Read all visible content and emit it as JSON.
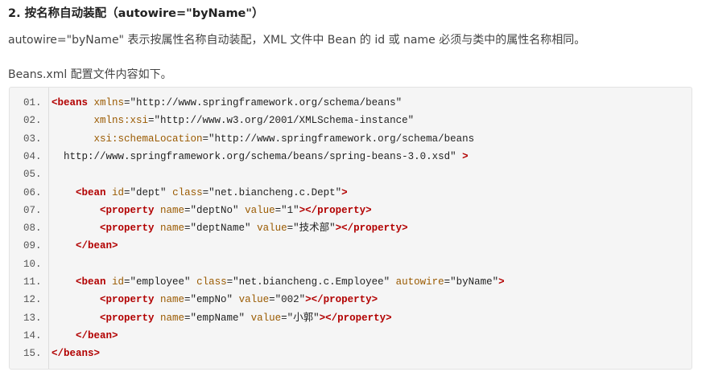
{
  "heading": "2. 按名称自动装配（autowire=\"byName\"）",
  "description": "autowire=\"byName\" 表示按属性名称自动装配，XML 文件中 Bean 的 id 或 name 必须与类中的属性名称相同。",
  "intro": "Beans.xml 配置文件内容如下。",
  "code": {
    "lines": [
      {
        "num": "01.",
        "indent": "",
        "parts": [
          {
            "t": "<beans",
            "c": "tag"
          },
          {
            "t": " xmlns",
            "c": "attr"
          },
          {
            "t": "=\"http://www.springframework.org/schema/beans\"",
            "c": "val"
          }
        ]
      },
      {
        "num": "02.",
        "indent": "       ",
        "parts": [
          {
            "t": "xmlns:xsi",
            "c": "attr"
          },
          {
            "t": "=\"http://www.w3.org/2001/XMLSchema-instance\"",
            "c": "val"
          }
        ]
      },
      {
        "num": "03.",
        "indent": "       ",
        "parts": [
          {
            "t": "xsi:schemaLocation",
            "c": "attr"
          },
          {
            "t": "=\"http://www.springframework.org/schema/beans",
            "c": "val"
          }
        ]
      },
      {
        "num": "04.",
        "indent": "  ",
        "parts": [
          {
            "t": "http://www.springframework.org/schema/beans/spring-beans-3.0.xsd\" ",
            "c": "val"
          },
          {
            "t": ">",
            "c": "tag"
          }
        ]
      },
      {
        "num": "05.",
        "indent": "",
        "parts": []
      },
      {
        "num": "06.",
        "indent": "    ",
        "parts": [
          {
            "t": "<bean",
            "c": "tag"
          },
          {
            "t": " id",
            "c": "attr"
          },
          {
            "t": "=\"dept\"",
            "c": "val"
          },
          {
            "t": " class",
            "c": "attr"
          },
          {
            "t": "=\"net.biancheng.c.Dept\"",
            "c": "val"
          },
          {
            "t": ">",
            "c": "tag"
          }
        ]
      },
      {
        "num": "07.",
        "indent": "        ",
        "parts": [
          {
            "t": "<property",
            "c": "tag"
          },
          {
            "t": " name",
            "c": "attr"
          },
          {
            "t": "=\"deptNo\"",
            "c": "val"
          },
          {
            "t": " value",
            "c": "attr"
          },
          {
            "t": "=\"1\"",
            "c": "val"
          },
          {
            "t": "></property>",
            "c": "tag"
          }
        ]
      },
      {
        "num": "08.",
        "indent": "        ",
        "parts": [
          {
            "t": "<property",
            "c": "tag"
          },
          {
            "t": " name",
            "c": "attr"
          },
          {
            "t": "=\"deptName\"",
            "c": "val"
          },
          {
            "t": " value",
            "c": "attr"
          },
          {
            "t": "=\"技术部\"",
            "c": "val"
          },
          {
            "t": "></property>",
            "c": "tag"
          }
        ]
      },
      {
        "num": "09.",
        "indent": "    ",
        "parts": [
          {
            "t": "</bean>",
            "c": "tag"
          }
        ]
      },
      {
        "num": "10.",
        "indent": "",
        "parts": []
      },
      {
        "num": "11.",
        "indent": "    ",
        "parts": [
          {
            "t": "<bean",
            "c": "tag"
          },
          {
            "t": " id",
            "c": "attr"
          },
          {
            "t": "=\"employee\"",
            "c": "val"
          },
          {
            "t": " class",
            "c": "attr"
          },
          {
            "t": "=\"net.biancheng.c.Employee\"",
            "c": "val"
          },
          {
            "t": " autowire",
            "c": "attr"
          },
          {
            "t": "=\"byName\"",
            "c": "val"
          },
          {
            "t": ">",
            "c": "tag"
          }
        ]
      },
      {
        "num": "12.",
        "indent": "        ",
        "parts": [
          {
            "t": "<property",
            "c": "tag"
          },
          {
            "t": " name",
            "c": "attr"
          },
          {
            "t": "=\"empNo\"",
            "c": "val"
          },
          {
            "t": " value",
            "c": "attr"
          },
          {
            "t": "=\"002\"",
            "c": "val"
          },
          {
            "t": "></property>",
            "c": "tag"
          }
        ]
      },
      {
        "num": "13.",
        "indent": "        ",
        "parts": [
          {
            "t": "<property",
            "c": "tag"
          },
          {
            "t": " name",
            "c": "attr"
          },
          {
            "t": "=\"empName\"",
            "c": "val"
          },
          {
            "t": " value",
            "c": "attr"
          },
          {
            "t": "=\"小郭\"",
            "c": "val"
          },
          {
            "t": "></property>",
            "c": "tag"
          }
        ]
      },
      {
        "num": "14.",
        "indent": "    ",
        "parts": [
          {
            "t": "</bean>",
            "c": "tag"
          }
        ]
      },
      {
        "num": "15.",
        "indent": "",
        "parts": [
          {
            "t": "</beans>",
            "c": "tag"
          }
        ]
      }
    ]
  }
}
